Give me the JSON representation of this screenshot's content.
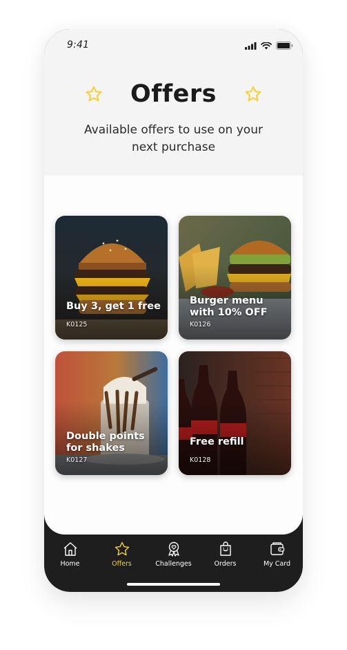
{
  "status": {
    "time": "9:41"
  },
  "header": {
    "title": "Offers",
    "subtitle": "Available offers to use on your next purchase"
  },
  "offers": [
    {
      "title": "Buy 3, get 1 free",
      "code": "K0125",
      "image": "stacked-burger-photo"
    },
    {
      "title": "Burger menu with 10% OFF",
      "code": "K0126",
      "image": "burger-and-fries-photo"
    },
    {
      "title": "Double points for shakes",
      "code": "K0127",
      "image": "milkshake-photo"
    },
    {
      "title": "Free refill",
      "code": "K0128",
      "image": "cola-bottles-photo"
    }
  ],
  "tabs": [
    {
      "label": "Home",
      "icon": "house-icon",
      "active": false
    },
    {
      "label": "Offers",
      "icon": "star-icon",
      "active": true
    },
    {
      "label": "Challenges",
      "icon": "badge-icon",
      "active": false
    },
    {
      "label": "Orders",
      "icon": "bag-icon",
      "active": false
    },
    {
      "label": "My Card",
      "icon": "wallet-icon",
      "active": false
    }
  ],
  "colors": {
    "accent": "#f5d23a",
    "tabbar": "#1e1e1e",
    "header_bg": "#f4f4f4",
    "text": "#1b1b1b"
  }
}
